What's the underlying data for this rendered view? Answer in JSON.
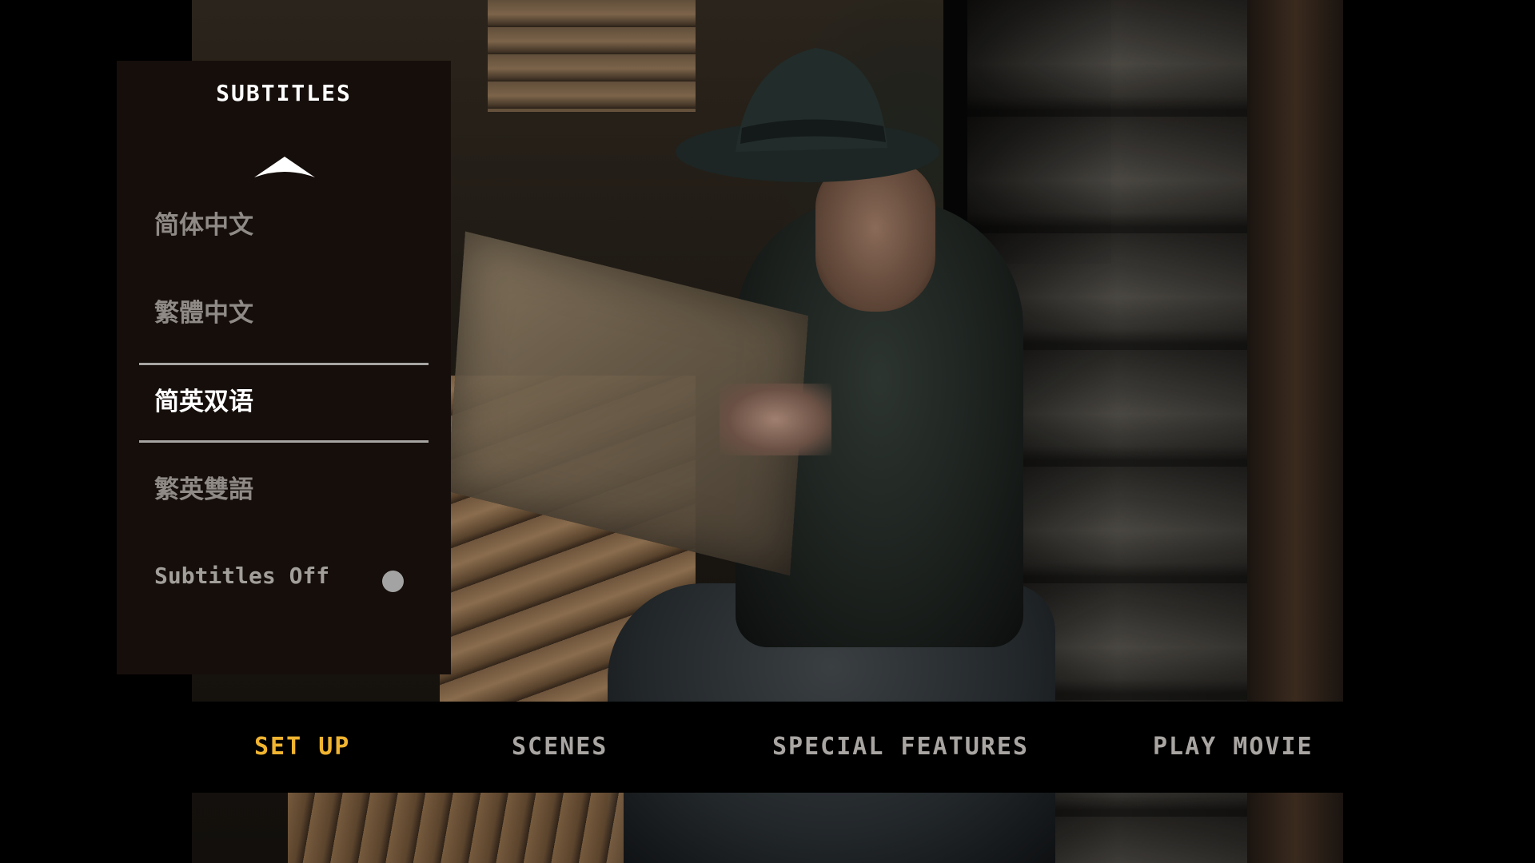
{
  "panel": {
    "title": "SUBTITLES",
    "up_arrow_icon": "chevron-up-icon",
    "items": [
      {
        "label": "简体中文",
        "selected": false
      },
      {
        "label": "繁體中文",
        "selected": false
      },
      {
        "label": "简英双语",
        "selected": true
      },
      {
        "label": "繁英雙語",
        "selected": false
      }
    ],
    "off_label": "Subtitles Off",
    "off_indicator_icon": "radio-dot-icon"
  },
  "nav": {
    "items": [
      {
        "label": "SET UP",
        "active": true
      },
      {
        "label": "SCENES",
        "active": false
      },
      {
        "label": "SPECIAL FEATURES",
        "active": false
      },
      {
        "label": "PLAY MOVIE",
        "active": false
      }
    ]
  },
  "colors": {
    "panel_bg": "#150e0b",
    "item_text": "#8f8a86",
    "selected_text": "#ffffff",
    "nav_active": "#f0b430",
    "nav_inactive": "#a8a5a2",
    "rule": "#a7a5a3"
  }
}
